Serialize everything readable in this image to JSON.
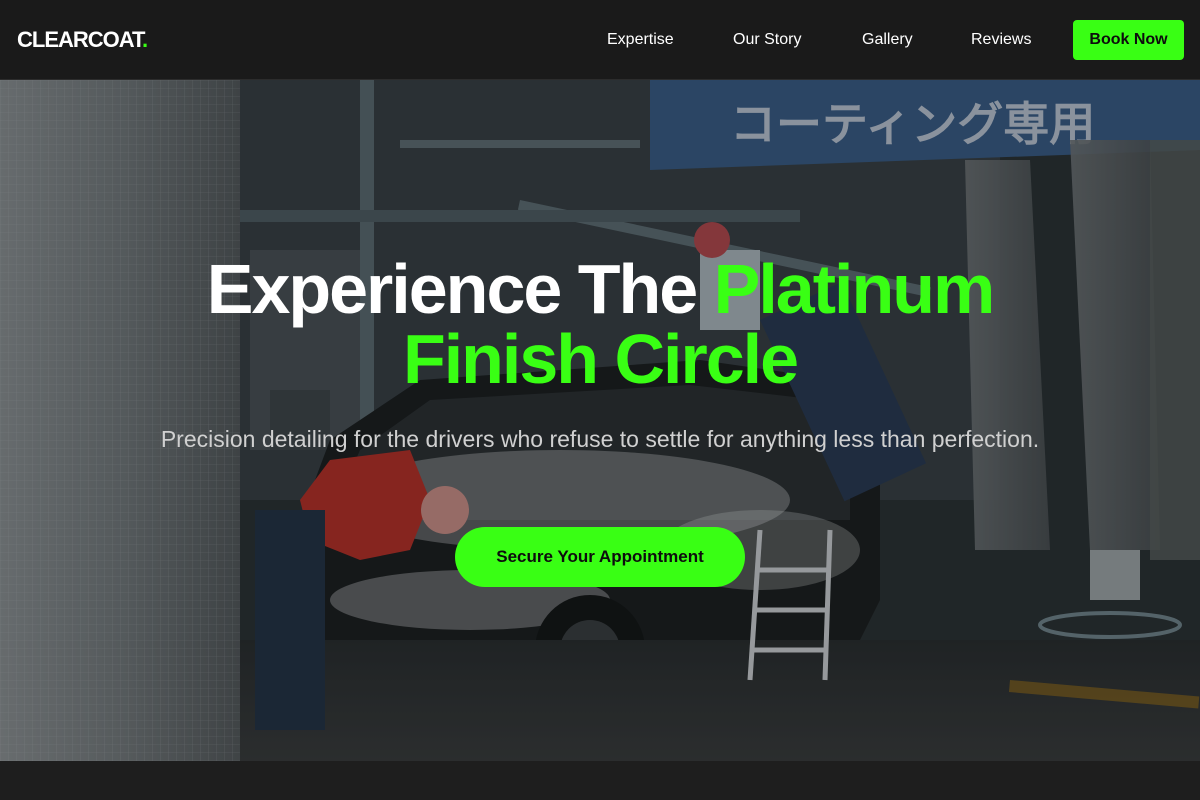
{
  "brand": {
    "name": "CLEARCOAT",
    "dot": ".",
    "accent_color": "#39ff14"
  },
  "nav": {
    "links": [
      {
        "label": "Expertise"
      },
      {
        "label": "Our Story"
      },
      {
        "label": "Gallery"
      },
      {
        "label": "Reviews"
      }
    ],
    "cta_label": "Book Now"
  },
  "hero": {
    "headline_white": "Experience The ",
    "headline_green_1": "Platinum",
    "headline_green_2": "Finish Circle",
    "subtitle": "Precision detailing for the drivers who refuse to settle for anything less than perfection.",
    "cta_label": "Secure Your Appointment",
    "background": "car-wash-photo"
  }
}
